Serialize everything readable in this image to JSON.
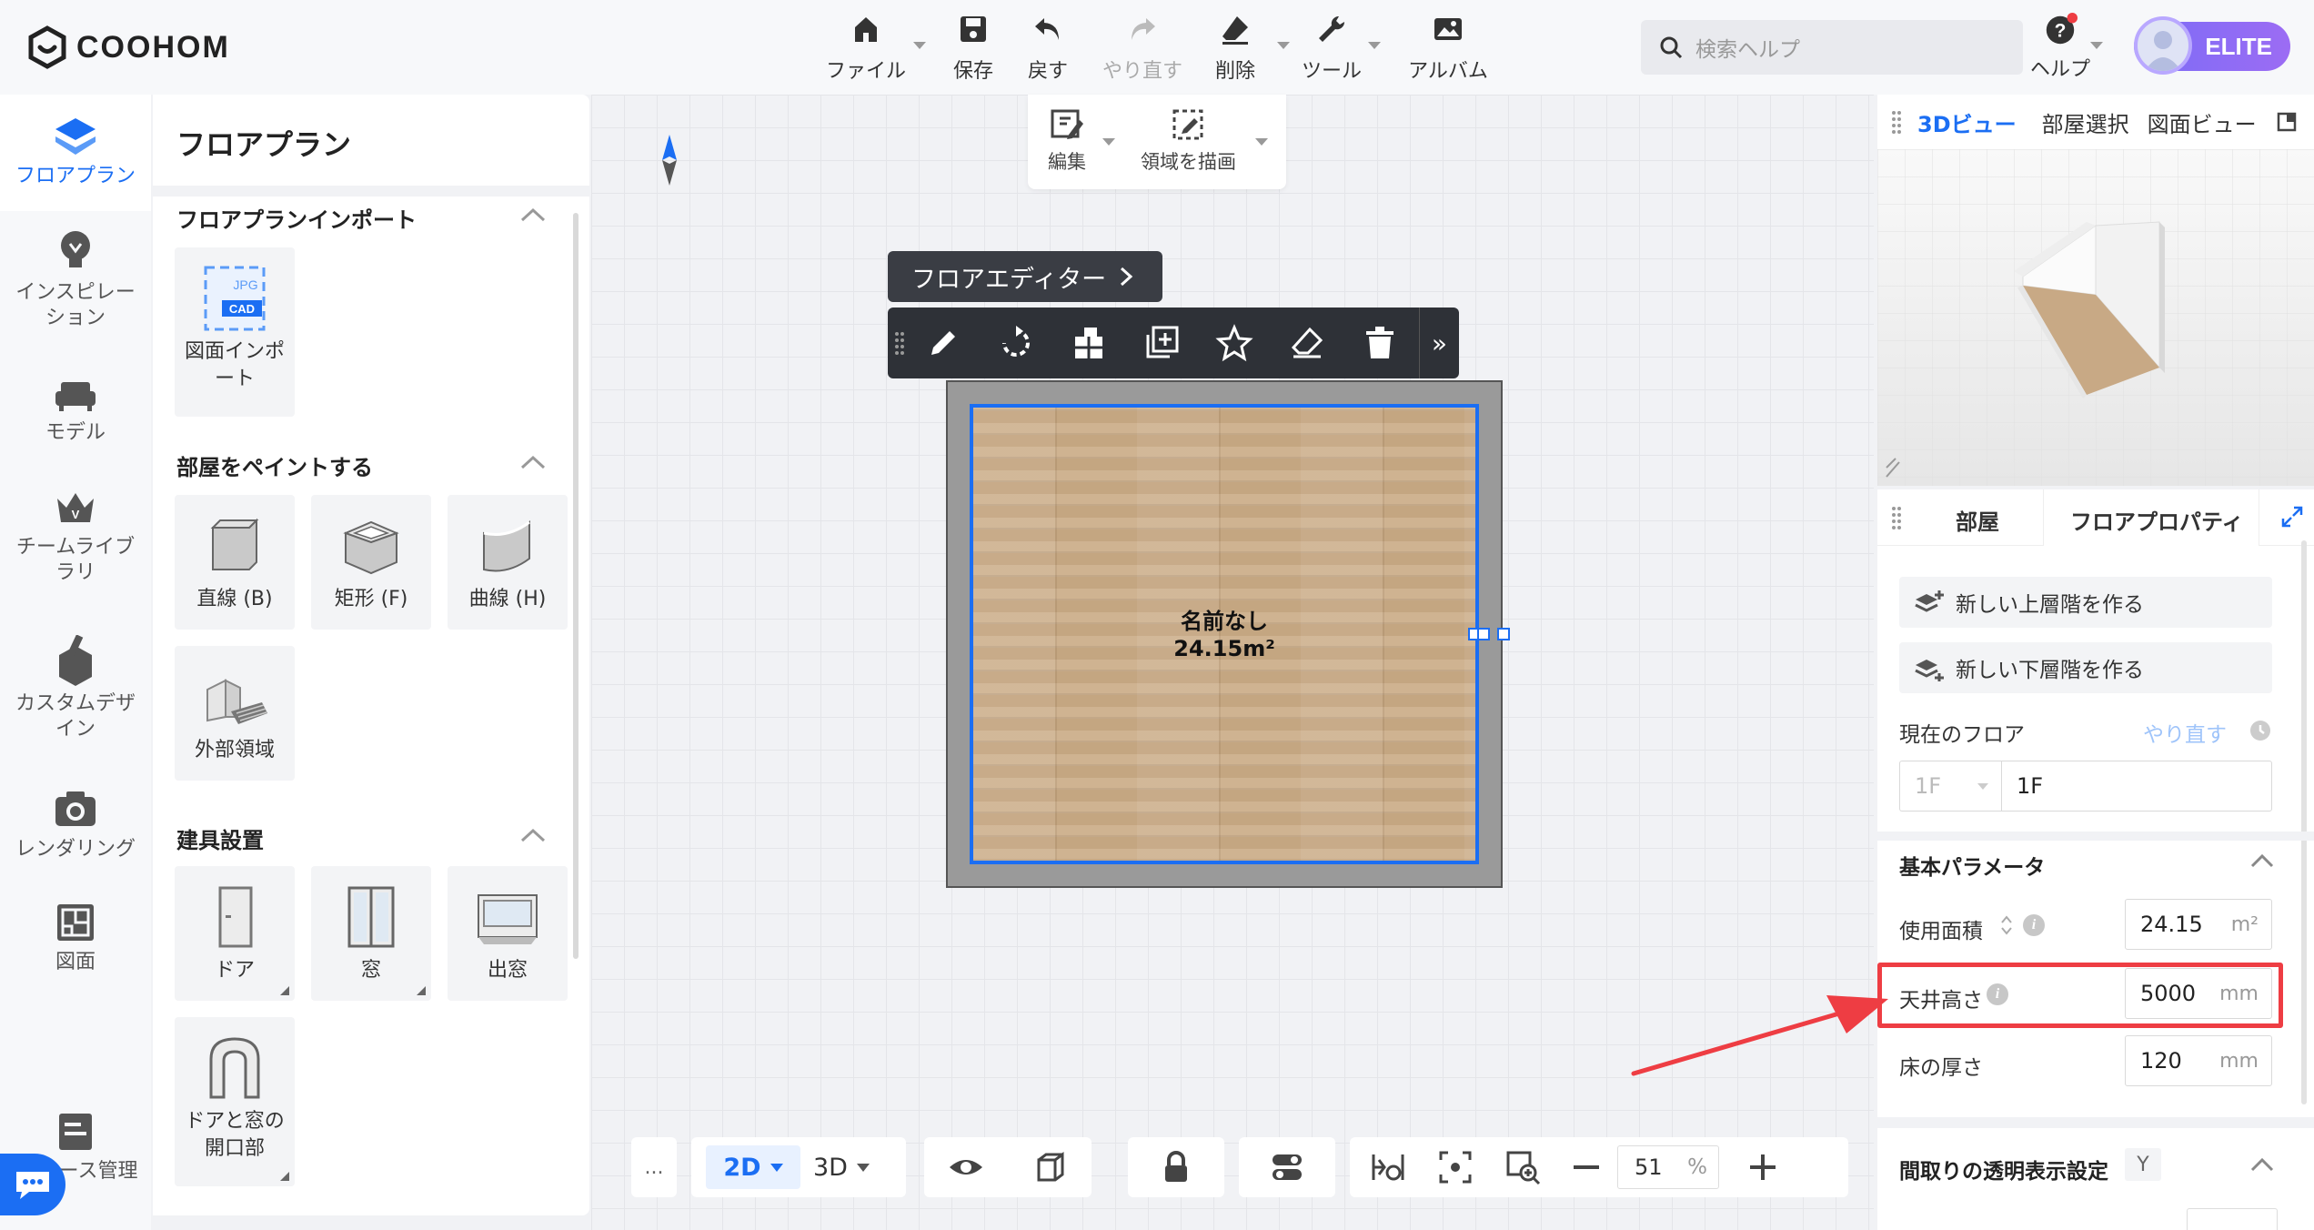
{
  "brand": {
    "name": "COOHOM"
  },
  "toolbar": {
    "file": "ファイル",
    "save": "保存",
    "undo": "戻す",
    "redo": "やり直す",
    "delete": "削除",
    "tools": "ツール",
    "album": "アルバム"
  },
  "search": {
    "placeholder": "検索ヘルプ"
  },
  "help": {
    "label": "ヘルプ"
  },
  "account": {
    "badge": "ELITE"
  },
  "leftnav": {
    "items": [
      {
        "label": "フロアプラン",
        "icon": "floorplan-icon",
        "active": true
      },
      {
        "label": "インスピレーション",
        "icon": "lightbulb-icon"
      },
      {
        "label": "モデル",
        "icon": "sofa-icon"
      },
      {
        "label": "チームライブラリ",
        "icon": "crown-icon"
      },
      {
        "label": "カスタムデザイン",
        "icon": "custom-design-icon"
      },
      {
        "label": "レンダリング",
        "icon": "camera-icon"
      },
      {
        "label": "図面",
        "icon": "blueprint-icon"
      },
      {
        "label": "ース管理",
        "icon": "resource-icon"
      }
    ]
  },
  "panel": {
    "title": "フロアプラン",
    "sections": [
      {
        "title": "フロアプランインポート",
        "cards": [
          {
            "label": "図面インポート",
            "thumb_jpg": "JPG",
            "thumb_cad": "CAD"
          }
        ]
      },
      {
        "title": "部屋をペイントする",
        "cards": [
          {
            "label": "直線 (B)"
          },
          {
            "label": "矩形 (F)"
          },
          {
            "label": "曲線 (H)"
          },
          {
            "label": "外部領域"
          }
        ]
      },
      {
        "title": "建具設置",
        "cards": [
          {
            "label": "ドア"
          },
          {
            "label": "窓"
          },
          {
            "label": "出窓"
          },
          {
            "label": "ドアと窓の開口部"
          }
        ]
      }
    ]
  },
  "edit_toolbar": {
    "edit": "編集",
    "draw_area": "領域を描画"
  },
  "floor_editor": {
    "label": "フロアエディター"
  },
  "room": {
    "name": "名前なし",
    "area": "24.15m²"
  },
  "bottom_bar": {
    "view2d": "2D",
    "view3d": "3D",
    "zoom": "51",
    "zoom_unit": "%",
    "more": "..."
  },
  "right_panel": {
    "tabs": [
      "3Dビュー",
      "部屋選択",
      "図面ビュー"
    ],
    "subtabs": [
      "部屋",
      "フロアプロパティ"
    ],
    "new_upper": "新しい上層階を作る",
    "new_lower": "新しい下層階を作る",
    "current_floor_label": "現在のフロア",
    "redo_link": "やり直す",
    "floor_select": "1F",
    "floor_name": "1F",
    "basic_params": "基本パラメータ",
    "area_label": "使用面積",
    "area_value": "24.15",
    "area_unit": "m²",
    "ceiling_label": "天井高さ",
    "ceiling_value": "5000",
    "ceiling_unit": "mm",
    "floor_thick_label": "床の厚さ",
    "floor_thick_value": "120",
    "floor_thick_unit": "mm",
    "transparency_label": "間取りの透明表示設定",
    "transparency_key": "Y"
  },
  "colors": {
    "accent": "#1b6ef3",
    "highlight": "#ee3d43",
    "toolbar_dark": "#2e3137"
  }
}
